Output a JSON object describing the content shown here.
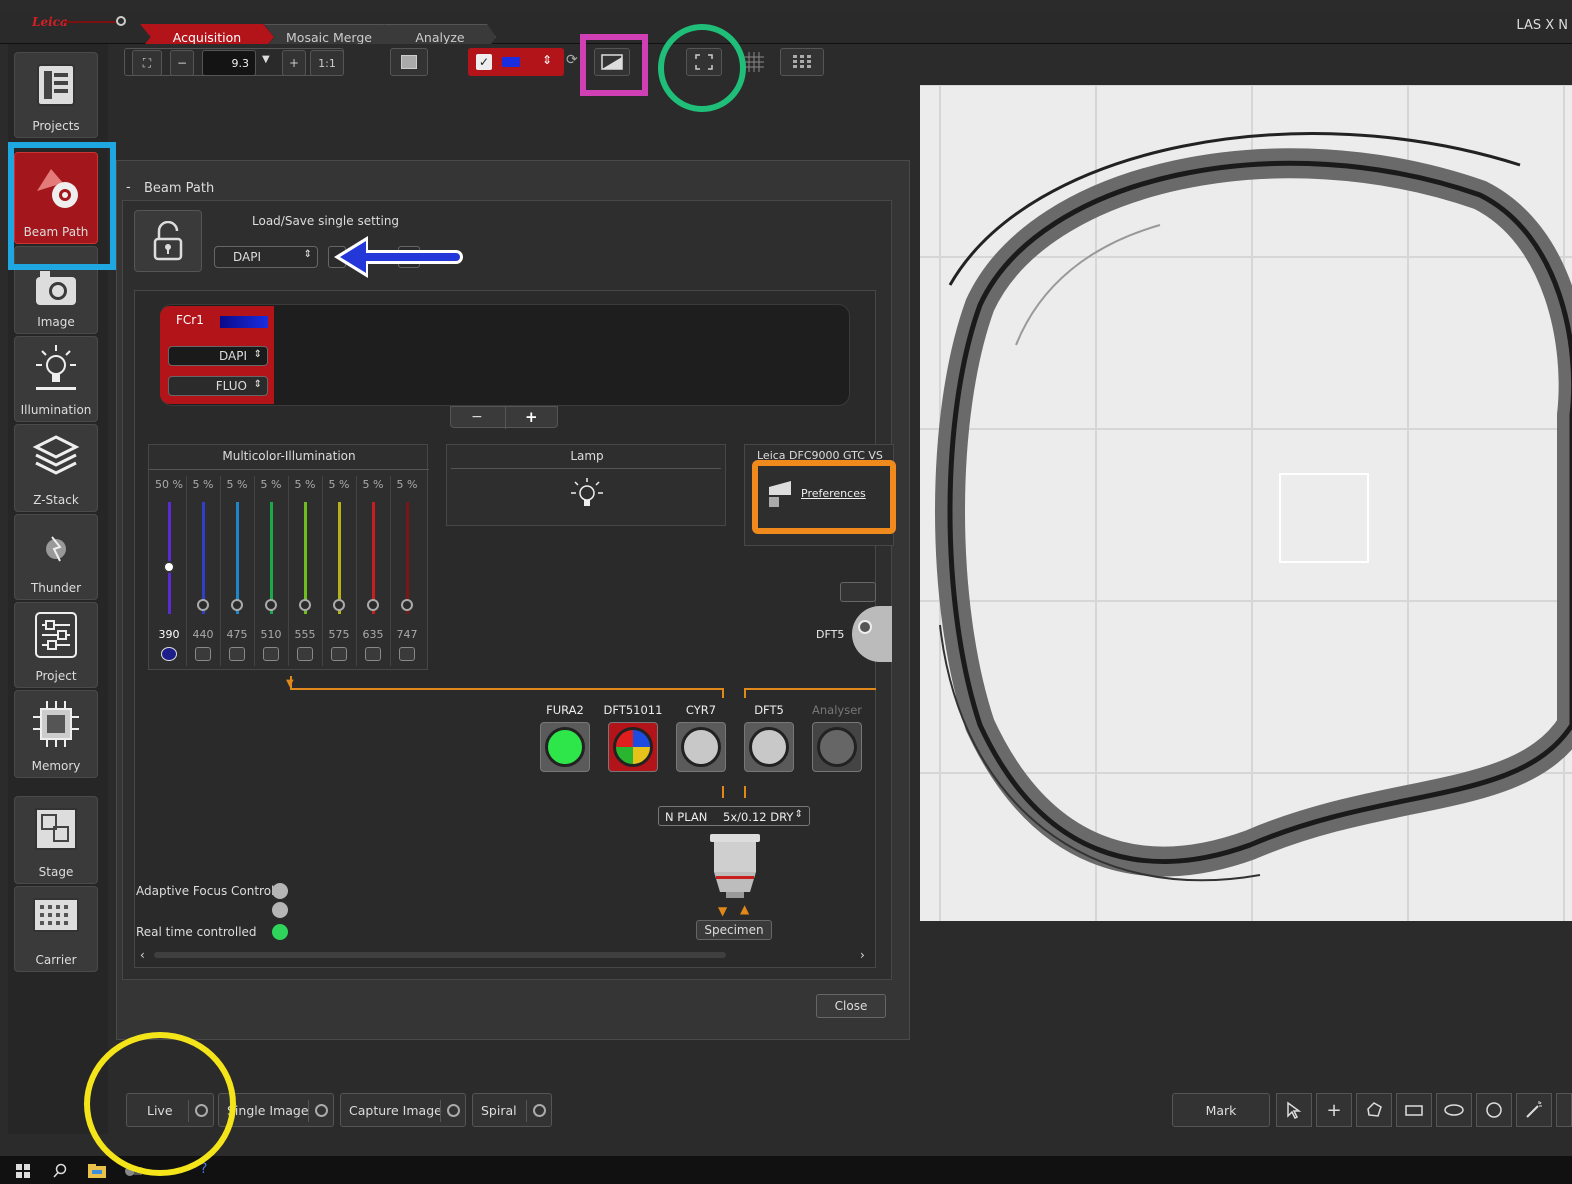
{
  "window": {
    "title": "LAS X N"
  },
  "workflow_tabs": [
    {
      "label": "Acquisition",
      "active": true
    },
    {
      "label": "Mosaic Merge",
      "active": false
    },
    {
      "label": "Analyze",
      "active": false
    }
  ],
  "toolbar": {
    "zoom_value": "9.3",
    "minus": "−",
    "plus": "+",
    "one_to_one": "1:1"
  },
  "sidebar": [
    {
      "label": "Projects",
      "icon": "projects-icon",
      "active": false
    },
    {
      "label": "Beam Path",
      "icon": "beam-path-icon",
      "active": true
    },
    {
      "label": "Image",
      "icon": "camera-icon",
      "active": false
    },
    {
      "label": "Illumination",
      "icon": "lamp-icon",
      "active": false
    },
    {
      "label": "Z-Stack",
      "icon": "layers-icon",
      "active": false
    },
    {
      "label": "Thunder",
      "icon": "thunder-icon",
      "active": false
    },
    {
      "label": "Project",
      "icon": "sliders-icon",
      "active": false
    },
    {
      "label": "Memory",
      "icon": "chip-icon",
      "active": false
    },
    {
      "label": "Stage",
      "icon": "stage-icon",
      "active": false
    },
    {
      "label": "Carrier",
      "icon": "carrier-icon",
      "active": false
    }
  ],
  "beam_path": {
    "title": "Beam Path",
    "collapse": "-",
    "load_save_label": "Load/Save single setting",
    "setting_value": "DAPI",
    "channel": {
      "name": "FCr1",
      "fluor": "DAPI",
      "mode": "FLUO"
    },
    "stepper": {
      "minus": "−",
      "plus": "+"
    },
    "multicolor": {
      "title": "Multicolor-Illumination",
      "channels": [
        {
          "percent": "50 %",
          "wavelength": "390",
          "color": "#5a2bd0",
          "checked": true,
          "level": 0.5
        },
        {
          "percent": "5 %",
          "wavelength": "440",
          "color": "#2f3fc7",
          "checked": false,
          "level": 0.05
        },
        {
          "percent": "5 %",
          "wavelength": "475",
          "color": "#1f86c9",
          "checked": false,
          "level": 0.05
        },
        {
          "percent": "5 %",
          "wavelength": "510",
          "color": "#1aa84a",
          "checked": false,
          "level": 0.05
        },
        {
          "percent": "5 %",
          "wavelength": "555",
          "color": "#6fbf1c",
          "checked": false,
          "level": 0.05
        },
        {
          "percent": "5 %",
          "wavelength": "575",
          "color": "#b7b216",
          "checked": false,
          "level": 0.05
        },
        {
          "percent": "5 %",
          "wavelength": "635",
          "color": "#c81e1e",
          "checked": false,
          "level": 0.05
        },
        {
          "percent": "5 %",
          "wavelength": "747",
          "color": "#7a1616",
          "checked": false,
          "level": 0.05
        }
      ]
    },
    "lamp": {
      "title": "Lamp"
    },
    "camera": {
      "title": "Leica DFC9000 GTC VS",
      "preferences": "Preferences"
    },
    "dft5_side": "DFT5",
    "filter_cubes": [
      {
        "label": "FURA2",
        "disk": "green"
      },
      {
        "label": "DFT51011",
        "disk": "quad"
      },
      {
        "label": "CYR7",
        "disk": "grey"
      },
      {
        "label": "DFT5",
        "disk": "grey"
      },
      {
        "label": "Analyser",
        "disk": "dark"
      }
    ],
    "objective": {
      "name": "N PLAN",
      "spec": "5x/0.12 DRY"
    },
    "specimen": "Specimen",
    "adaptive_focus": "Adaptive Focus Control",
    "realtime": "Real time controlled",
    "close": "Close"
  },
  "bottom": {
    "buttons": [
      "Live",
      "Single Image",
      "Capture Image",
      "Spiral"
    ],
    "mark": "Mark"
  },
  "colors": {
    "accent_red": "#b3141a",
    "annotation_blue": "#1ea7e1",
    "annotation_magenta": "#d13fb5",
    "annotation_green": "#1fbf7a",
    "annotation_orange": "#f08a1c",
    "annotation_yellow": "#f4e51a",
    "arrow_blue": "#2437d8"
  }
}
